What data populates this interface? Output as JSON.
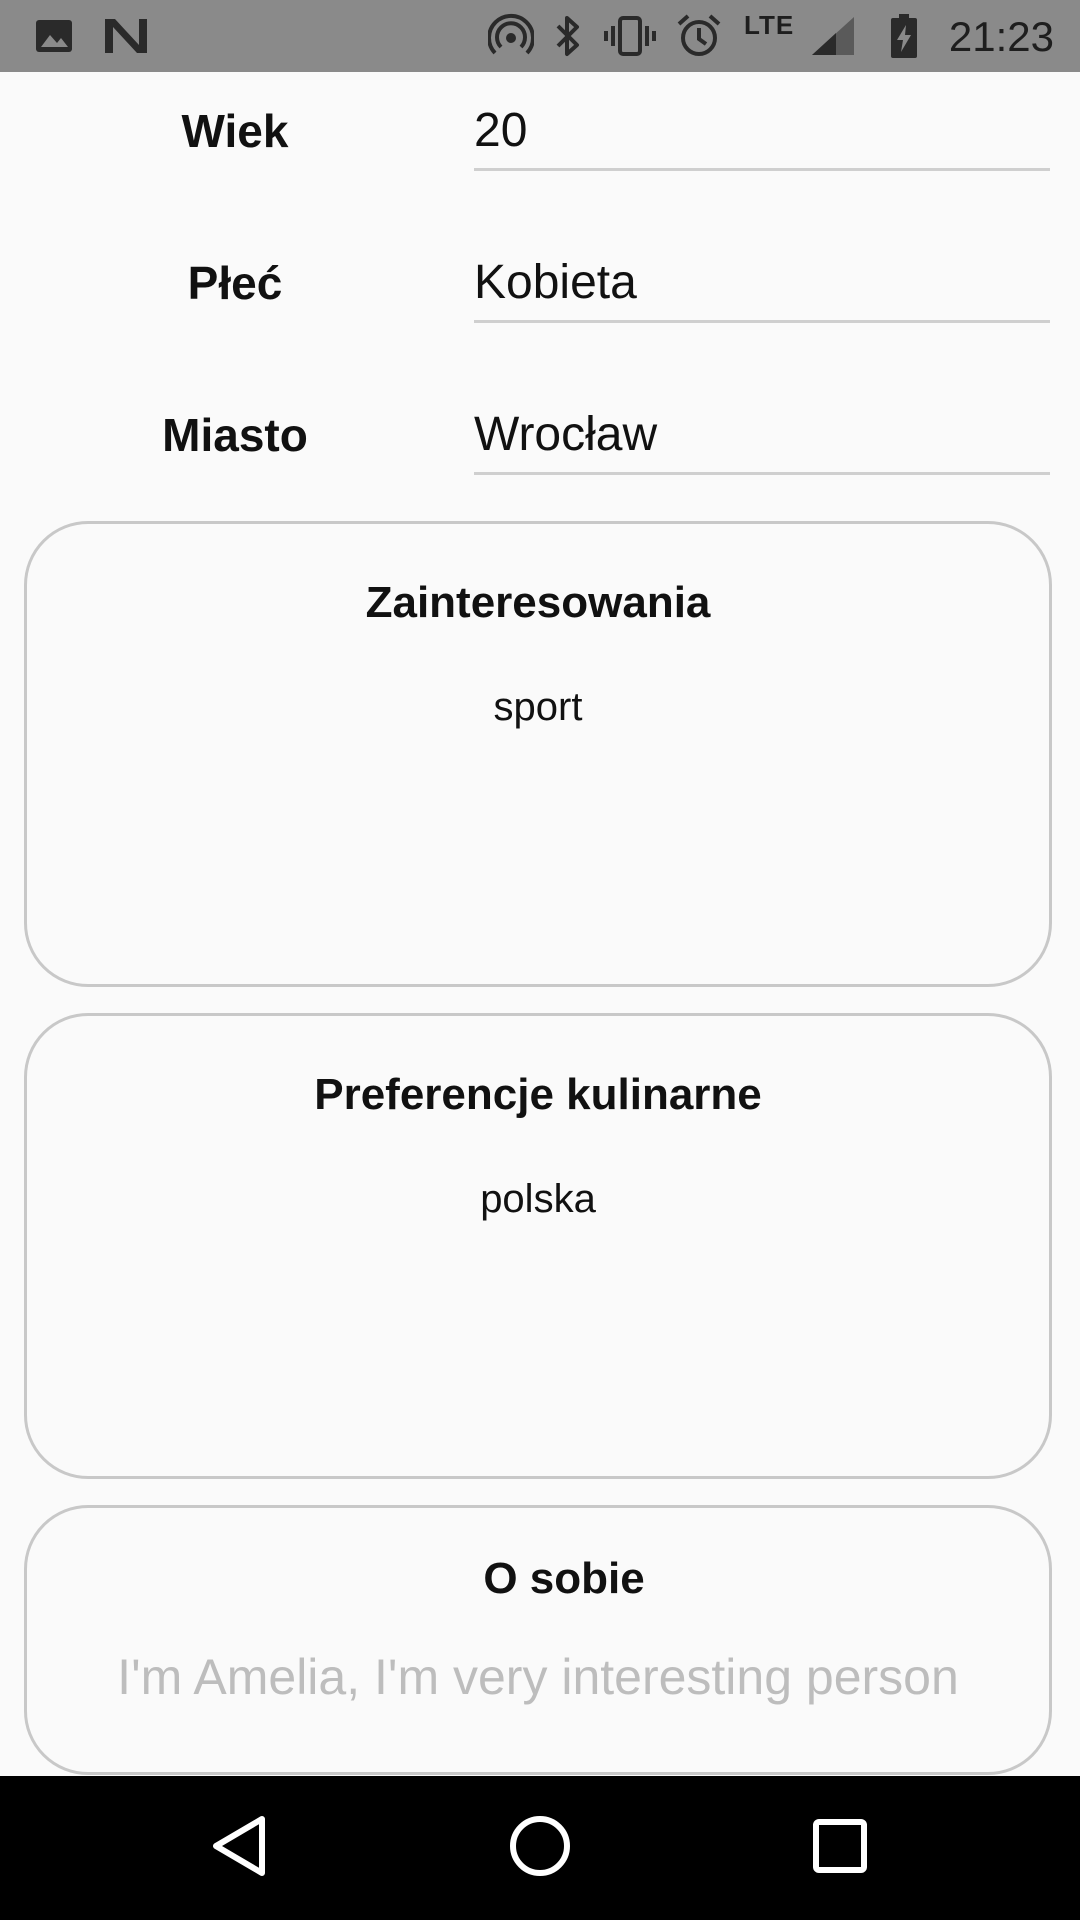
{
  "status_bar": {
    "time": "21:23",
    "network": "LTE",
    "icons": [
      "image-icon",
      "n-logo-icon",
      "hotspot-icon",
      "bluetooth-icon",
      "vibrate-icon",
      "alarm-icon",
      "signal-icon",
      "battery-charging-icon"
    ]
  },
  "profile": {
    "age": {
      "label": "Wiek",
      "value": "20"
    },
    "gender": {
      "label": "Płeć",
      "value": "Kobieta"
    },
    "city": {
      "label": "Miasto",
      "value": "Wrocław"
    }
  },
  "interests": {
    "title": "Zainteresowania",
    "text": "sport"
  },
  "food": {
    "title": "Preferencje kulinarne",
    "text": "polska"
  },
  "about": {
    "title": "O sobie",
    "placeholder": "I'm Amelia, I'm very interesting person"
  },
  "nav_bar": {
    "buttons": [
      "back-icon",
      "home-icon",
      "recents-icon"
    ]
  }
}
